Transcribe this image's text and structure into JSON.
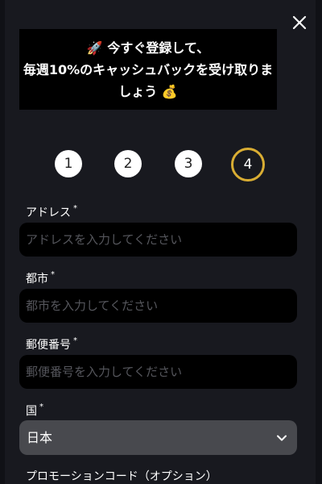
{
  "banner": {
    "line1_emoji": "🚀",
    "line1": "今すぐ登録して、",
    "line2": "毎週10%のキャッシュバックを受け取りま",
    "line3": "しょう",
    "line3_emoji": "💰"
  },
  "steps": [
    {
      "label": "1"
    },
    {
      "label": "2"
    },
    {
      "label": "3"
    },
    {
      "label": "4",
      "active": true
    }
  ],
  "form": {
    "address": {
      "label": "アドレス",
      "required_mark": "*",
      "placeholder": "アドレスを入力してください",
      "value": ""
    },
    "city": {
      "label": "都市",
      "required_mark": "*",
      "placeholder": "都市を入力してください",
      "value": ""
    },
    "postal_code": {
      "label": "郵便番号",
      "required_mark": "*",
      "placeholder": "郵便番号を入力してください",
      "value": ""
    },
    "country": {
      "label": "国",
      "required_mark": "*",
      "selected": "日本"
    },
    "promo_code": {
      "label": "プロモーションコード（オプション）"
    }
  },
  "colors": {
    "background": "#18191f",
    "input_bg": "#000000",
    "select_bg": "#48494e",
    "active_step_ring": "#d9ad33",
    "placeholder": "#55565c"
  },
  "icons": {
    "close": "close-icon",
    "select_chevron": "chevron-down-icon",
    "rocket": "rocket-icon",
    "money_bag": "money-bag-icon"
  }
}
